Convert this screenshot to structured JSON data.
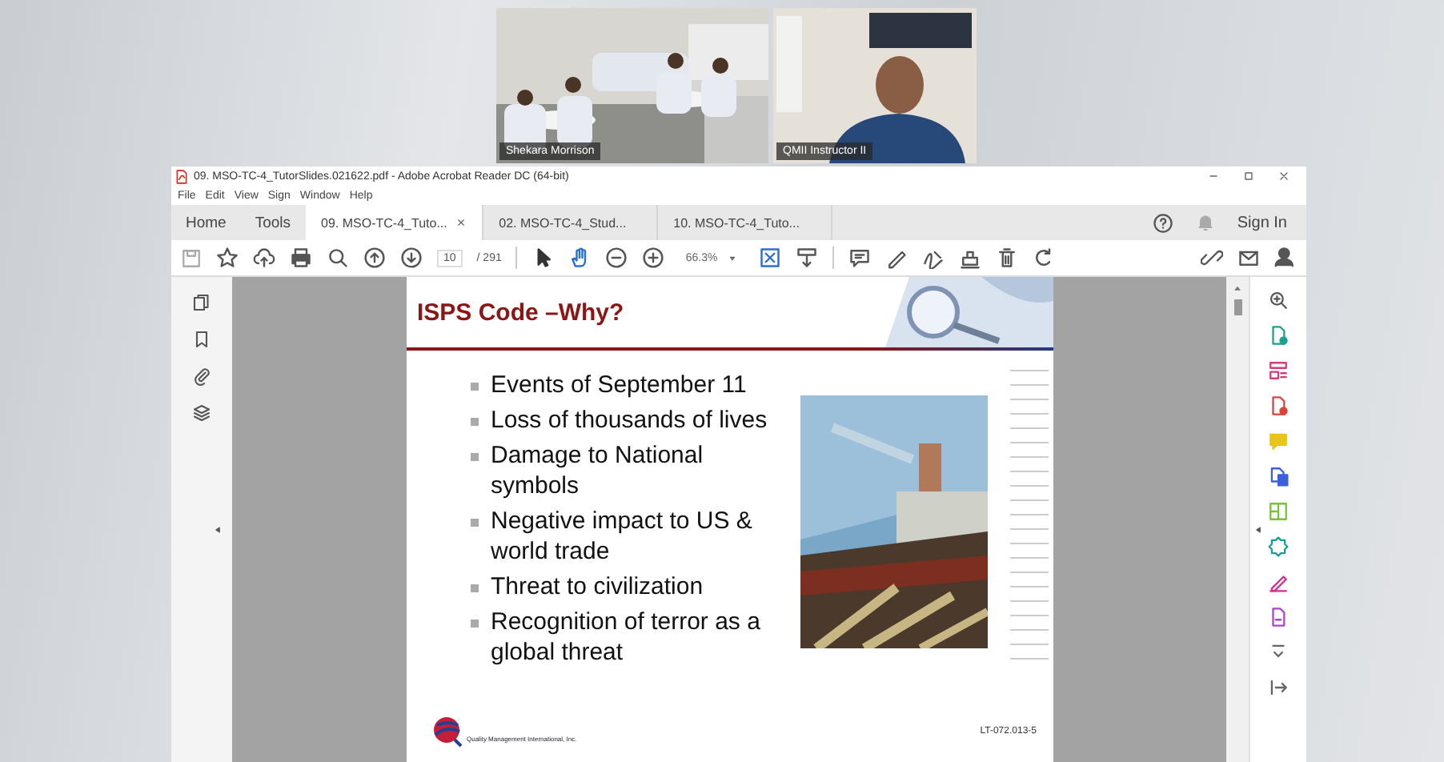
{
  "call": {
    "tiles": [
      {
        "name": "Shekara Morrison",
        "kind": "picture"
      },
      {
        "name": "QMII Instructor II",
        "kind": "picture"
      }
    ]
  },
  "window": {
    "title": "09. MSO-TC-4_TutorSlides.021622.pdf - Adobe Acrobat Reader DC (64-bit)"
  },
  "menu": [
    "File",
    "Edit",
    "View",
    "Sign",
    "Window",
    "Help"
  ],
  "nav": [
    "Home",
    "Tools"
  ],
  "tabs": [
    {
      "label": "09. MSO-TC-4_Tuto...",
      "selected": true,
      "close": "×"
    },
    {
      "label": "02. MSO-TC-4_Stud...",
      "selected": false
    },
    {
      "label": "10. MSO-TC-4_Tuto...",
      "selected": false
    }
  ],
  "sign_in": "Sign In",
  "toolbar": {
    "page": "10",
    "page_count": "/ 291",
    "zoom": "66.3%"
  },
  "slide": {
    "title": "ISPS Code –Why?",
    "bullets": [
      [
        "Events of September 11"
      ],
      [
        "Loss of thousands of lives"
      ],
      [
        "Damage to National",
        "symbols"
      ],
      [
        "Negative impact to US &",
        "world trade"
      ],
      [
        "Threat to civilization"
      ],
      [
        "Recognition of terror as a",
        "global threat"
      ]
    ],
    "company": "Quality Management International, Inc.",
    "code": "LT-072.013-5"
  }
}
